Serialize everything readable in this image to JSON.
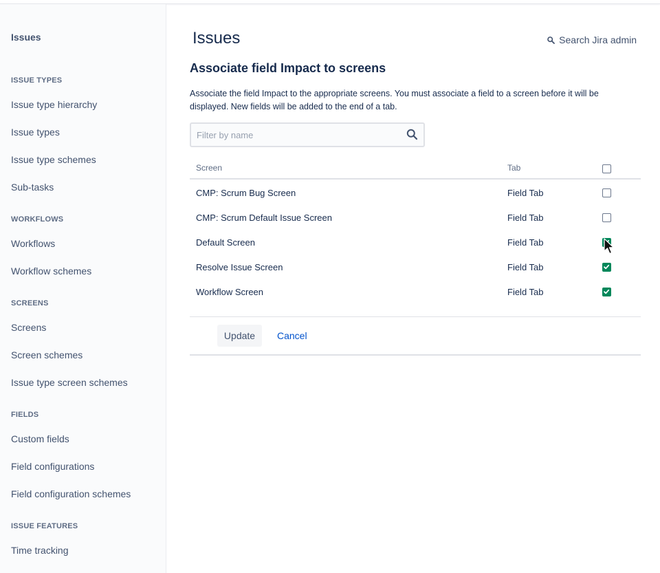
{
  "sidebar": {
    "title": "Issues",
    "sections": [
      {
        "label": "ISSUE TYPES",
        "items": [
          "Issue type hierarchy",
          "Issue types",
          "Issue type schemes",
          "Sub-tasks"
        ]
      },
      {
        "label": "WORKFLOWS",
        "items": [
          "Workflows",
          "Workflow schemes"
        ]
      },
      {
        "label": "SCREENS",
        "items": [
          "Screens",
          "Screen schemes",
          "Issue type screen schemes"
        ]
      },
      {
        "label": "FIELDS",
        "items": [
          "Custom fields",
          "Field configurations",
          "Field configuration schemes"
        ]
      },
      {
        "label": "ISSUE FEATURES",
        "items": [
          "Time tracking"
        ]
      }
    ]
  },
  "header": {
    "title": "Issues",
    "search_admin": "Search Jira admin"
  },
  "main": {
    "subtitle": "Associate field Impact to screens",
    "description": "Associate the field Impact to the appropriate screens. You must associate a field to a screen before it will be displayed. New fields will be added to the end of a tab.",
    "filter_placeholder": "Filter by name",
    "table": {
      "col_screen": "Screen",
      "col_tab": "Tab",
      "select_all_checked": false,
      "rows": [
        {
          "screen": "CMP: Scrum Bug Screen",
          "tab": "Field Tab",
          "checked": false
        },
        {
          "screen": "CMP: Scrum Default Issue Screen",
          "tab": "Field Tab",
          "checked": false
        },
        {
          "screen": "Default Screen",
          "tab": "Field Tab",
          "checked": true
        },
        {
          "screen": "Resolve Issue Screen",
          "tab": "Field Tab",
          "checked": true
        },
        {
          "screen": "Workflow Screen",
          "tab": "Field Tab",
          "checked": true
        }
      ]
    },
    "update_label": "Update",
    "cancel_label": "Cancel"
  },
  "colors": {
    "checkbox_checked": "#00875A",
    "link": "#0052CC"
  }
}
